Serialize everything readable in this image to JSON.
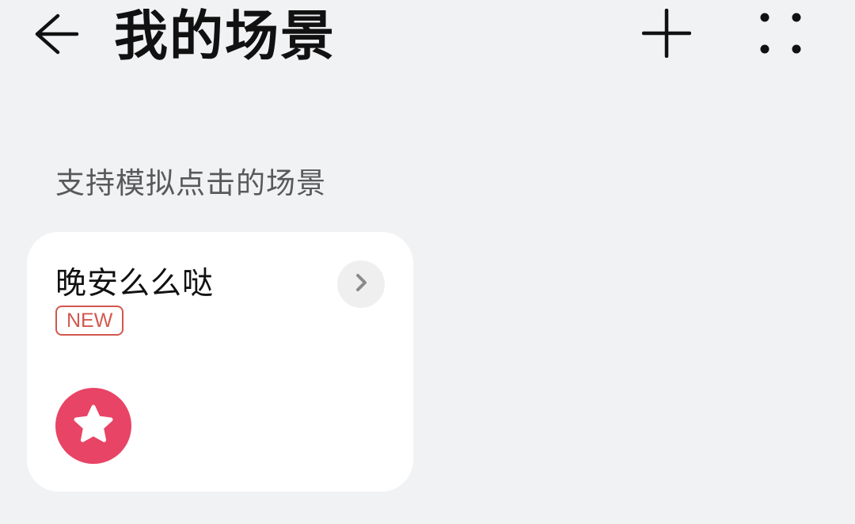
{
  "header": {
    "title": "我的场景",
    "back_icon": "arrow-left-icon",
    "add_icon": "plus-icon",
    "more_icon": "four-dots-icon"
  },
  "section": {
    "title": "支持模拟点击的场景"
  },
  "scenes": [
    {
      "name": "晚安么么哒",
      "badge": "NEW",
      "icon": "star-icon",
      "icon_color": "#e84466",
      "badge_color": "#d2584f"
    }
  ]
}
